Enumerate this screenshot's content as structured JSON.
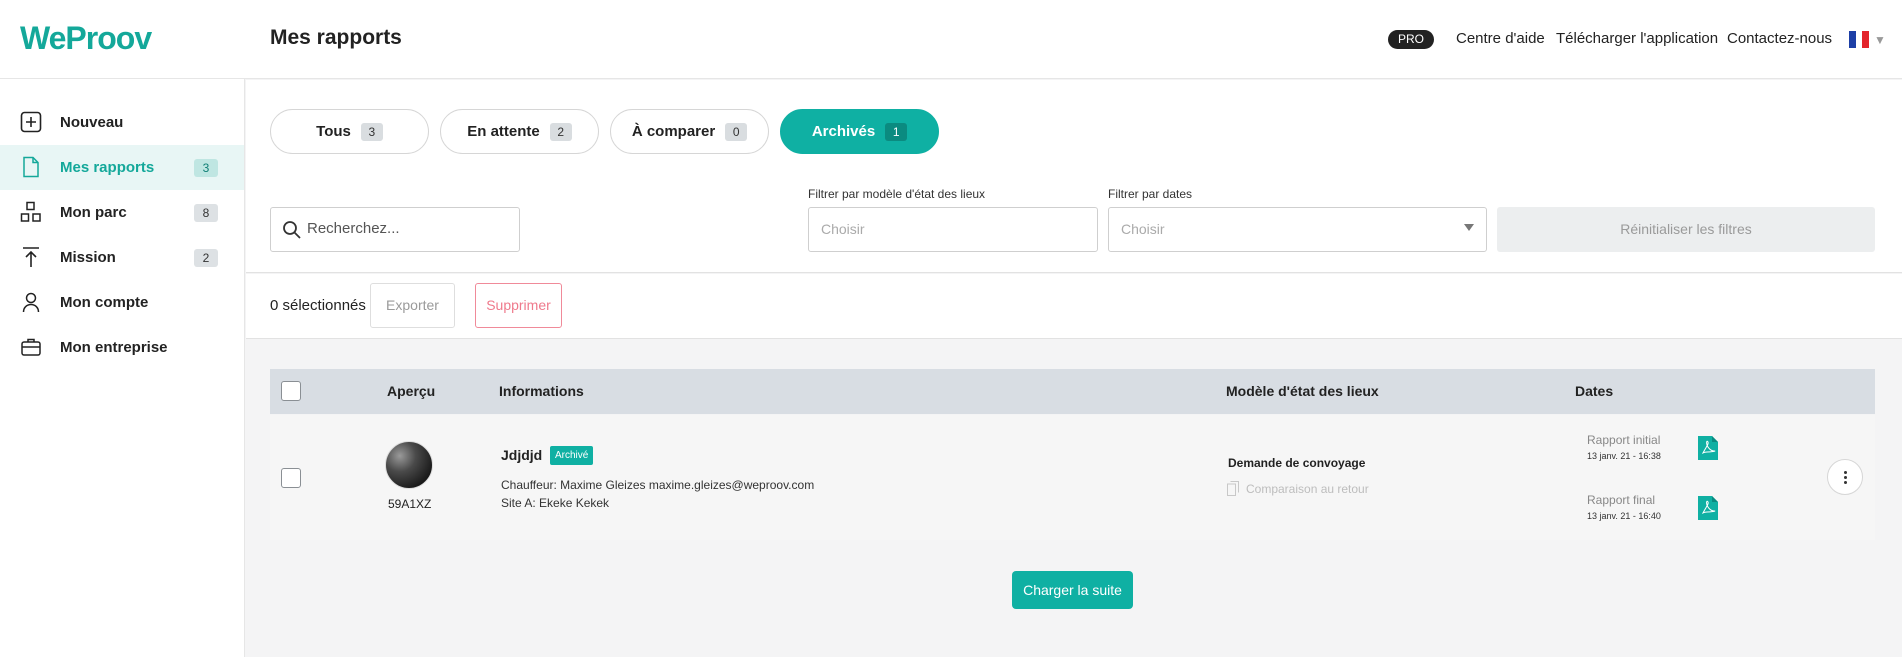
{
  "header": {
    "logo": "WeProov",
    "title": "Mes rapports",
    "badge": "PRO",
    "links": [
      "Centre d'aide",
      "Télécharger l'application",
      "Contactez-nous"
    ],
    "language_icon": "flag-fr-icon"
  },
  "sidebar": {
    "items": [
      {
        "label": "Nouveau",
        "count": "",
        "icon": "plus-square-icon"
      },
      {
        "label": "Mes rapports",
        "count": "3",
        "icon": "document-icon"
      },
      {
        "label": "Mon parc",
        "count": "8",
        "icon": "grid-icon"
      },
      {
        "label": "Mission",
        "count": "2",
        "icon": "upload-arrow-icon"
      },
      {
        "label": "Mon compte",
        "count": "",
        "icon": "user-icon"
      },
      {
        "label": "Mon entreprise",
        "count": "",
        "icon": "briefcase-icon"
      }
    ]
  },
  "tabs": [
    {
      "label": "Tous",
      "count": "3"
    },
    {
      "label": "En attente",
      "count": "2"
    },
    {
      "label": "À comparer",
      "count": "0"
    },
    {
      "label": "Archivés",
      "count": "1"
    }
  ],
  "filters": {
    "search_placeholder": "Recherchez...",
    "model_label": "Filtrer par modèle d'état des lieux",
    "model_placeholder": "Choisir",
    "dates_label": "Filtrer par dates",
    "dates_placeholder": "Choisir",
    "reset_label": "Réinitialiser les filtres"
  },
  "bulk": {
    "selected": "0 sélectionnés",
    "export": "Exporter",
    "delete": "Supprimer"
  },
  "table": {
    "headers": {
      "preview": "Aperçu",
      "info": "Informations",
      "model": "Modèle d'état des lieux",
      "dates": "Dates"
    },
    "rows": [
      {
        "plate": "59A1XZ",
        "title": "Jdjdjd",
        "status": "Archivé",
        "driver": "Chauffeur: Maxime Gleizes maxime.gleizes@weproov.com",
        "site": "Site A: Ekeke Kekek",
        "model": "Demande de convoyage",
        "comparison": "Comparaison au retour",
        "initial_label": "Rapport initial",
        "initial_date": "13 janv. 21 - 16:38",
        "final_label": "Rapport final",
        "final_date": "13 janv. 21 - 16:40"
      }
    ]
  },
  "load_more": "Charger la suite",
  "colors": {
    "accent": "#0fb0a3",
    "danger": "#ef7a8c"
  }
}
